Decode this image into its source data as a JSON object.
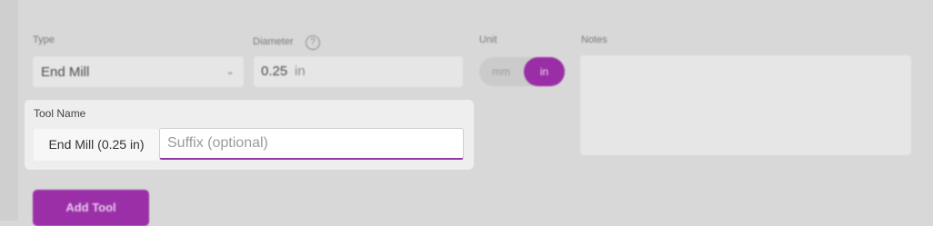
{
  "form": {
    "type_label": "Type",
    "type_value": "End Mill",
    "diameter_label": "Diameter",
    "diameter_value": "0.25",
    "diameter_unit": "in",
    "help_glyph": "?",
    "unit_label": "Unit",
    "unit_options": [
      "mm",
      "in"
    ],
    "unit_selected": "in",
    "notes_label": "Notes",
    "add_tool_label": "Add Tool"
  },
  "tool_name": {
    "label": "Tool Name",
    "prefix": "End Mill (0.25 in)",
    "suffix_placeholder": "Suffix (optional)",
    "suffix_value": ""
  },
  "colors": {
    "accent": "#9b2fa8",
    "focus_border": "#8e3aa0"
  }
}
